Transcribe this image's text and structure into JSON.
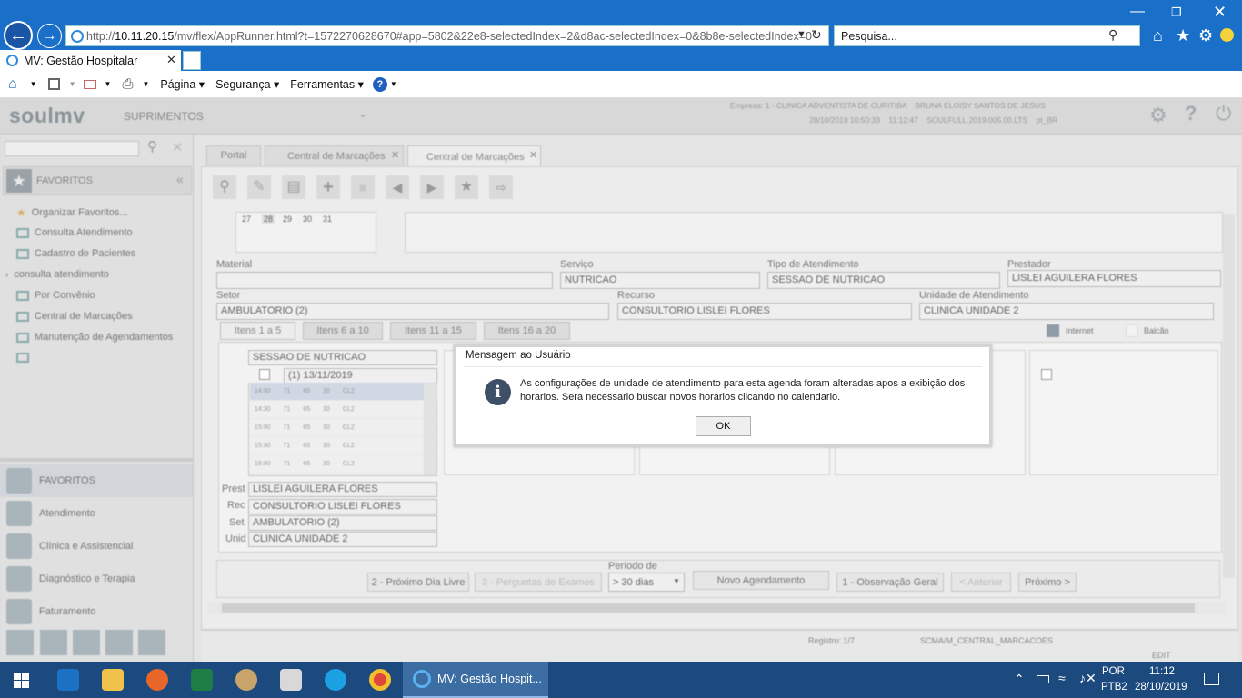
{
  "browser": {
    "url_prefix": "http://",
    "url_host": "10.11.20.15",
    "url_rest": "/mv/flex/AppRunner.html?t=1572270628670#app=5802&22e8-selectedIndex=2&d8ac-selectedIndex=0&8b8e-selectedIndex=0",
    "search_placeholder": "Pesquisa...",
    "tab_title": "MV: Gestão Hospitalar",
    "menu": {
      "pagina": "Página",
      "seguranca": "Segurança",
      "ferramentas": "Ferramentas"
    }
  },
  "app": {
    "logo": "soulmv",
    "module": "SUPRIMENTOS",
    "empresa_line": "Empresa: 1 - CLINICA ADVENTISTA DE CURITIBA    BRUNA ELOISY SANTOS DE JESUS",
    "session_line": "28/10/2019 10:50:33    11:12:47    SOULFULL.2019.005.00.LTS    pt_BR",
    "tabs": [
      "Portal",
      "Central de Marcações",
      "Central de Marcações"
    ],
    "sidebar": {
      "favoritos_header": "FAVORITOS",
      "items": [
        "Organizar Favoritos...",
        "Consulta Atendimento",
        "Cadastro de Pacientes",
        "consulta atendimento",
        "Por Convênio",
        "Central de Marcações",
        "Manutenção de Agendamentos"
      ],
      "groups": [
        "FAVORITOS",
        "Atendimento",
        "Clínica e Assistencial",
        "Diagnóstico e Terapia",
        "Faturamento"
      ]
    },
    "calendar_days": [
      "27",
      "28",
      "29",
      "30",
      "31"
    ],
    "form": {
      "material_label": "Material",
      "material_value": "",
      "servico_label": "Serviço",
      "servico_value": "NUTRICAO",
      "tipo_label": "Tipo de Atendimento",
      "tipo_value": "SESSAO DE NUTRICAO",
      "prestador_label": "Prestador",
      "prestador_value": "LISLEI AGUILERA FLORES",
      "setor_label": "Setor",
      "setor_value": "AMBULATORIO (2)",
      "recurso_label": "Recurso",
      "recurso_value": "CONSULTORIO LISLEI FLORES",
      "unidade_label": "Unidade de Atendimento",
      "unidade_value": "CLINICA UNIDADE 2"
    },
    "item_tabs": [
      "Itens 1 a 5",
      "Itens 6 a 10",
      "Itens 11 a 15",
      "Itens 16 a 20"
    ],
    "legend": {
      "internet": "Internet",
      "balcao": "Balcão"
    },
    "agenda": {
      "title": "SESSAO DE NUTRICAO",
      "date": "(1)   13/11/2019",
      "slots": [
        [
          "14:00",
          "71",
          "65",
          "30",
          "CL2"
        ],
        [
          "14:30",
          "71",
          "65",
          "30",
          "CL2"
        ],
        [
          "15:00",
          "71",
          "65",
          "30",
          "CL2"
        ],
        [
          "15:30",
          "71",
          "65",
          "30",
          "CL2"
        ],
        [
          "16:00",
          "71",
          "65",
          "30",
          "CL2"
        ]
      ],
      "prest_label": "Prest",
      "prest_value": "LISLEI AGUILERA FLORES",
      "rec_label": "Rec",
      "rec_value": "CONSULTORIO LISLEI FLORES",
      "set_label": "Set",
      "set_value": "AMBULATORIO (2)",
      "unid_label": "Unid",
      "unid_value": "CLINICA UNIDADE 2"
    },
    "bottom": {
      "periodo_label": "Período de",
      "periodo_value": "> 30 dias",
      "buttons": [
        "2 - Próximo Dia Livre",
        "3 - Perguntas de Exames",
        "Novo Agendamento",
        "1 - Observação Geral",
        "< Anterior",
        "Próximo >"
      ]
    },
    "status": {
      "registro": "Registro: 1/7",
      "form_name": "SCMA/M_CENTRAL_MARCACOES",
      "mode": "EDIT"
    }
  },
  "dialog": {
    "title": "Mensagem ao Usuário",
    "message": "As configurações de unidade de atendimento para esta agenda foram alteradas apos a exibição dos horarios. Sera necessario buscar novos horarios clicando no calendario.",
    "ok_label": "OK"
  },
  "taskbar": {
    "active_app": "MV: Gestão Hospit...",
    "lang_top": "POR",
    "lang_bottom": "PTB2",
    "time": "11:12",
    "date": "28/10/2019"
  }
}
